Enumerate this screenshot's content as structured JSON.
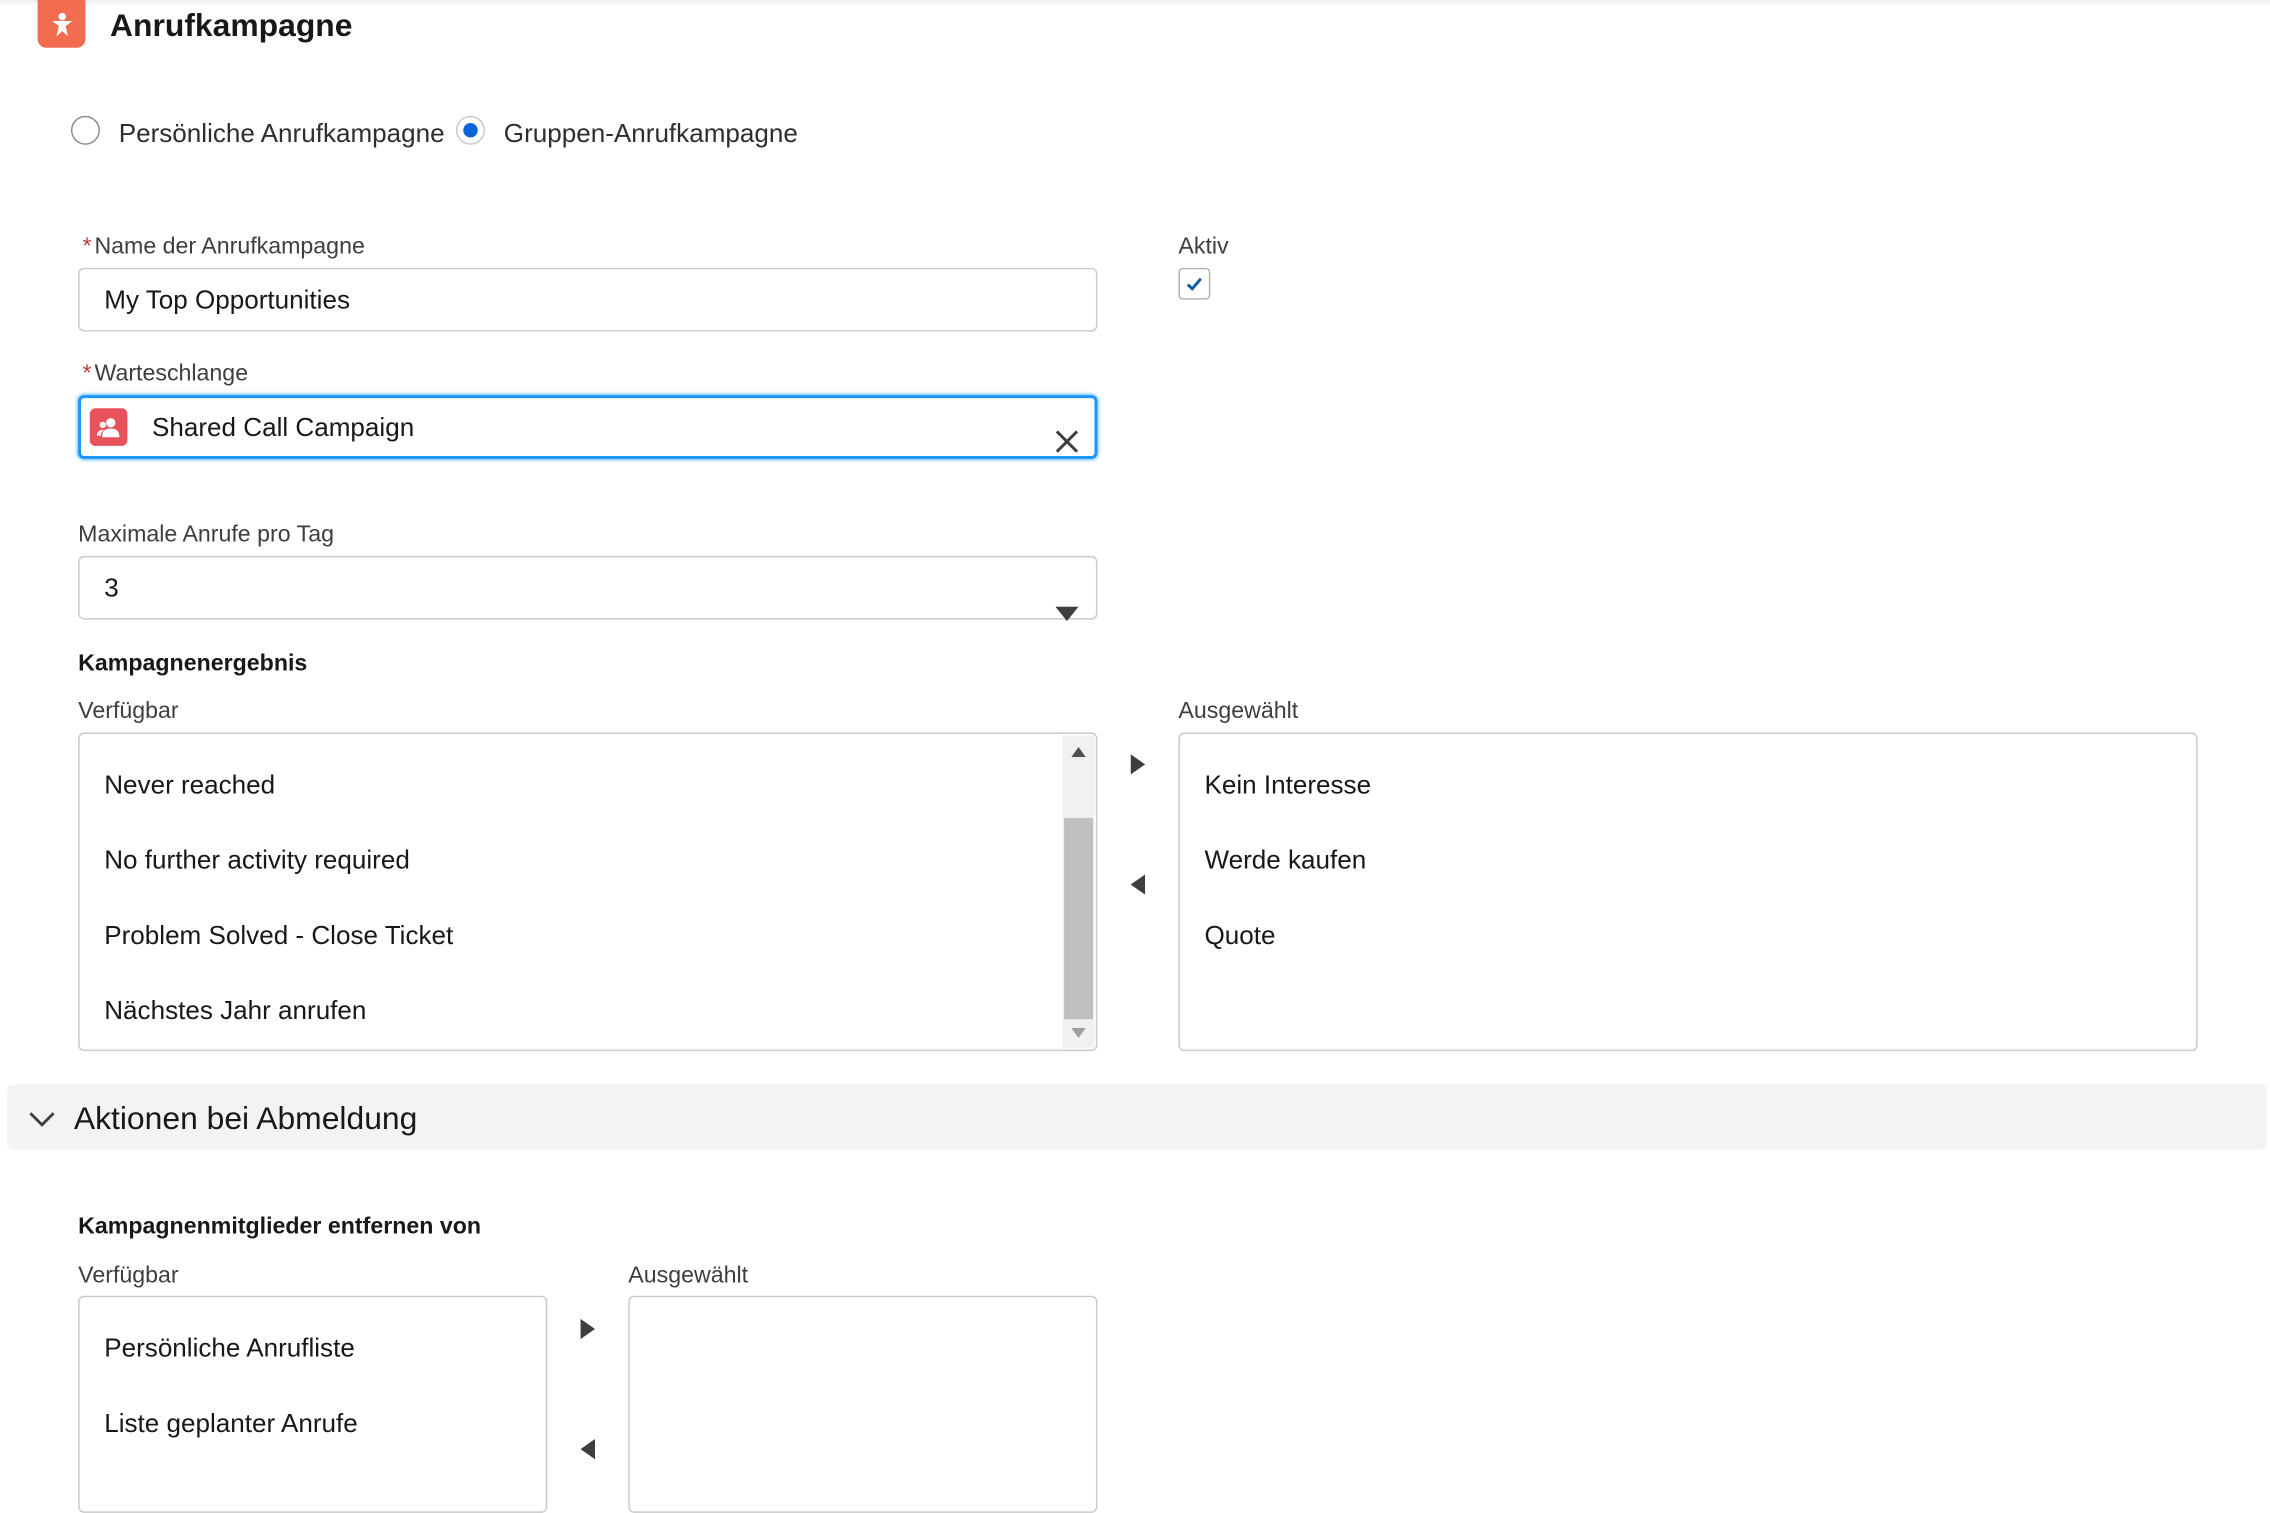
{
  "header": {
    "title": "Anrufkampagne",
    "icon": "campaign-star-icon",
    "icon_color": "#f26d4f"
  },
  "type_choice": {
    "options": [
      "Persönliche Anrufkampagne",
      "Gruppen-Anrufkampagne"
    ],
    "selected_index": 1,
    "accent": "#0b64d8"
  },
  "form": {
    "name": {
      "label": "Name der Anrufkampagne",
      "required_mark": "*",
      "value": "My Top Opportunities"
    },
    "active": {
      "label": "Aktiv",
      "checked": true
    },
    "queue": {
      "label": "Warteschlange",
      "required_mark": "*",
      "value": "Shared Call Campaign",
      "icon": "group-icon",
      "icon_color": "#e8535b",
      "clear_icon": "close-icon"
    },
    "max_calls": {
      "label": "Maximale Anrufe pro Tag",
      "value": "3",
      "icon": "chevron-down-icon"
    }
  },
  "campaign_result": {
    "title": "Kampagnenergebnis",
    "available_label": "Verfügbar",
    "selected_label": "Ausgewählt",
    "available": [
      "Never reached",
      "No further activity required",
      "Problem Solved - Close Ticket",
      "Nächstes Jahr anrufen"
    ],
    "selected": [
      "Kein Interesse",
      "Werde kaufen",
      "Quote"
    ]
  },
  "unsubscribe_section": {
    "title": "Aktionen bei Abmeldung",
    "expanded": true
  },
  "remove_members": {
    "title": "Kampagnenmitglieder entfernen von",
    "available_label": "Verfügbar",
    "selected_label": "Ausgewählt",
    "available": [
      "Persönliche Anrufliste",
      "Liste geplanter Anrufe"
    ],
    "selected": []
  }
}
